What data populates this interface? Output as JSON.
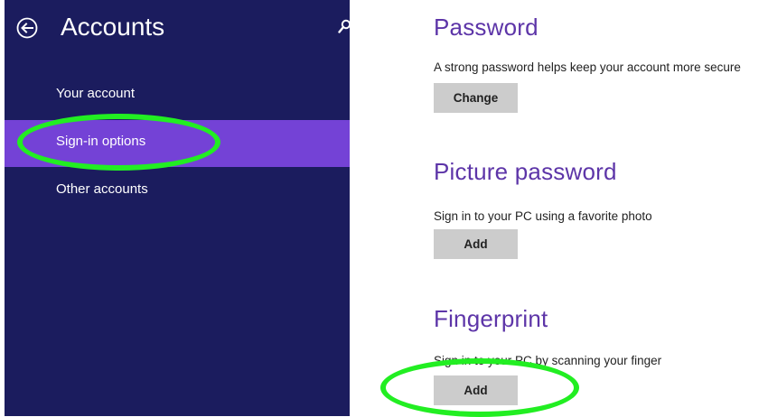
{
  "sidebar": {
    "title": "Accounts",
    "icons": {
      "back": "back-arrow-icon",
      "search": "search-icon"
    },
    "items": [
      {
        "label": "Your account",
        "active": false
      },
      {
        "label": "Sign-in options",
        "active": true
      },
      {
        "label": "Other accounts",
        "active": false
      }
    ]
  },
  "main": {
    "password": {
      "title": "Password",
      "description": "A strong password helps keep your account more secure",
      "button": "Change"
    },
    "picture_password": {
      "title": "Picture password",
      "description": "Sign in to your PC using a favorite photo",
      "button": "Add"
    },
    "fingerprint": {
      "title": "Fingerprint",
      "description": "Sign in to your PC by scanning your finger",
      "button": "Add"
    }
  },
  "colors": {
    "sidebar_bg": "#1b1c5e",
    "active_item": "#7442d6",
    "title": "#5d35a8",
    "button_bg": "#cccccc",
    "highlight": "#22ee22"
  }
}
